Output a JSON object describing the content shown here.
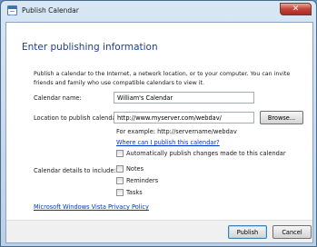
{
  "window": {
    "title": "Publish Calendar",
    "close_symbol": "✕"
  },
  "dialog": {
    "heading": "Enter publishing information",
    "intro": "Publish a calendar to the Internet, a network location, or to your computer. You can invite friends and family who use compatible calendars to view it.",
    "calendar_name_label": "Calendar name:",
    "calendar_name_value": "William's Calendar",
    "location_label": "Location to publish calendar:",
    "location_value": "http://www.myserver.com/webdav/",
    "browse_label": "Browse...",
    "example_text": "For example: http://servername/webdav",
    "where_link": "Where can I publish this calendar?",
    "auto_publish_label": "Automatically publish changes made to this calendar",
    "auto_publish_checked": false,
    "details_label": "Calendar details to include:",
    "details": [
      {
        "label": "Notes",
        "checked": false
      },
      {
        "label": "Reminders",
        "checked": false
      },
      {
        "label": "Tasks",
        "checked": false
      }
    ],
    "privacy_link": "Microsoft Windows Vista Privacy Policy",
    "publish_label": "Publish",
    "cancel_label": "Cancel"
  },
  "icons": {
    "app": "calendar-icon",
    "close": "close-icon"
  }
}
